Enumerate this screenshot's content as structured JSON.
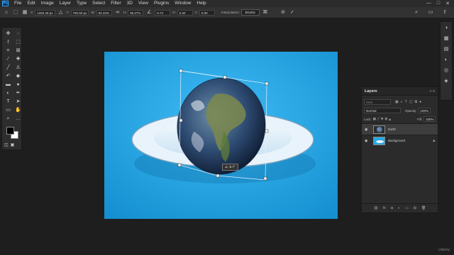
{
  "app": {
    "logo": "Ps"
  },
  "menu": [
    "File",
    "Edit",
    "Image",
    "Layer",
    "Type",
    "Select",
    "Filter",
    "3D",
    "View",
    "Plugins",
    "Window",
    "Help"
  ],
  "window_controls": [
    "—",
    "□",
    "✕"
  ],
  "options": {
    "x_label": "X:",
    "x_value": "1284.49 px",
    "y_label": "Y:",
    "y_value": "782.50 px",
    "w_label": "W:",
    "w_value": "92.22%",
    "h_label": "H:",
    "h_value": "96.27%",
    "angle_value": "8.74",
    "hskew_label": "H:",
    "hskew_value": "6.32",
    "vskew_label": "V:",
    "vskew_value": "0.00",
    "interp_label": "Interpolation:",
    "interp_value": "Bicubic"
  },
  "transform_readout": "∠: 8.7°",
  "layers_panel": {
    "title": "Layers",
    "search_placeholder": "Kind",
    "blend_mode": "Normal",
    "opacity_label": "Opacity:",
    "opacity_value": "100%",
    "lock_label": "Lock:",
    "fill_label": "Fill:",
    "fill_value": "100%",
    "layers": [
      {
        "name": "Earth",
        "active": true
      },
      {
        "name": "Background",
        "active": false,
        "locked": true
      }
    ]
  },
  "watermark": "Udemy",
  "colors": {
    "canvas_bg": "#26a8e8",
    "ui_dark": "#2b2b2b",
    "accent": "#31a8ff"
  }
}
